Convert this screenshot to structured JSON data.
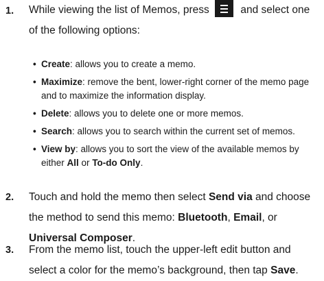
{
  "steps": [
    {
      "number": "1.",
      "text_before_icon": "While viewing the list of Memos, press",
      "icon": "menu-icon",
      "text_after_icon": "and select one of the following options:"
    },
    {
      "number": "2.",
      "t1": "Touch and hold the memo then select ",
      "b1": "Send via",
      "t2": " and choose the method to send this memo: ",
      "b2": "Bluetooth",
      "t3": ", ",
      "b3": "Email",
      "t4": ", or ",
      "b4": "Universal Composer",
      "t5": "."
    },
    {
      "number": "3.",
      "t1": "From the memo list, touch the upper-left edit button and select a color for the memo’s background, then tap ",
      "b1": "Save",
      "t2": "."
    }
  ],
  "options": [
    {
      "bullet": "•",
      "name": "Create",
      "desc": ": allows you to create a memo."
    },
    {
      "bullet": "•",
      "name": "Maximize",
      "desc": ": remove the bent, lower-right corner of the memo page and to maximize the information display."
    },
    {
      "bullet": "•",
      "name": "Delete",
      "desc": ": allows you to delete one or more memos."
    },
    {
      "bullet": "•",
      "name": "Search",
      "desc": ": allows you to search within the current set of memos."
    },
    {
      "bullet": "•",
      "name": "View by",
      "desc": ": allows you to sort the view of the available memos by either ",
      "opt1": "All",
      "mid": " or ",
      "opt2": "To-do Only",
      "end": "."
    }
  ]
}
